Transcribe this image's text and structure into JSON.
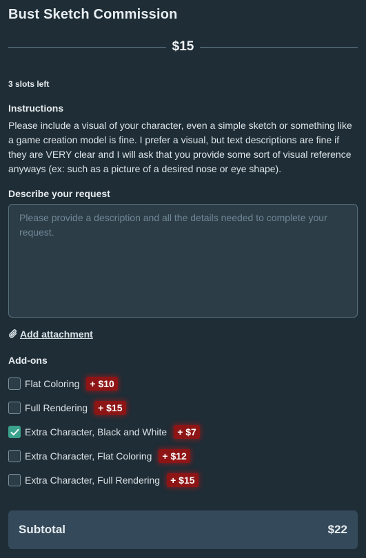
{
  "title": "Bust Sketch Commission",
  "price": "$15",
  "slots": "3 slots left",
  "instructions": {
    "label": "Instructions",
    "text": "Please include a visual of your character, even a simple sketch or something like a game creation model is fine. I prefer a visual, but text descriptions are fine if they are VERY clear and I will ask that you provide some sort of visual reference anyways (ex: such as a picture of a desired nose or eye shape)."
  },
  "request": {
    "label": "Describe your request",
    "placeholder": "Please provide a description and all the details needed to complete your request.",
    "value": ""
  },
  "attachment": {
    "label": "Add attachment",
    "icon": "paperclip-icon"
  },
  "addons": {
    "label": "Add-ons",
    "items": [
      {
        "name": "Flat Coloring",
        "price": "+ $10",
        "checked": false
      },
      {
        "name": "Full Rendering",
        "price": "+ $15",
        "checked": false
      },
      {
        "name": "Extra Character, Black and White",
        "price": "+ $7",
        "checked": true
      },
      {
        "name": "Extra Character, Flat Coloring",
        "price": "+ $12",
        "checked": false
      },
      {
        "name": "Extra Character, Full Rendering",
        "price": "+ $15",
        "checked": false
      }
    ]
  },
  "subtotal": {
    "label": "Subtotal",
    "value": "$22"
  },
  "colors": {
    "background": "#1f2d36",
    "accent_check": "#3aa28c",
    "price_badge": "#8e1515",
    "subtotal_bar": "#34495a"
  }
}
